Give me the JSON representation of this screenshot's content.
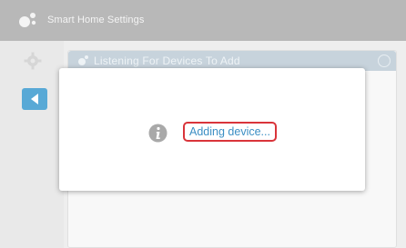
{
  "app": {
    "title": "Smart Home Settings",
    "logo_icon": "smart-home-logo-icon"
  },
  "sidebar": {
    "settings_icon": "gear-icon",
    "back_icon": "back-arrow-icon",
    "accent": "#58a9d6"
  },
  "panel": {
    "title": "Listening For Devices To Add",
    "header_icon": "antenna-icon",
    "close_icon": "close-icon"
  },
  "dialog": {
    "icon": "info-icon",
    "status": "Adding device...",
    "status_color": "#3d8fc4",
    "highlight_color": "#d9343a"
  }
}
